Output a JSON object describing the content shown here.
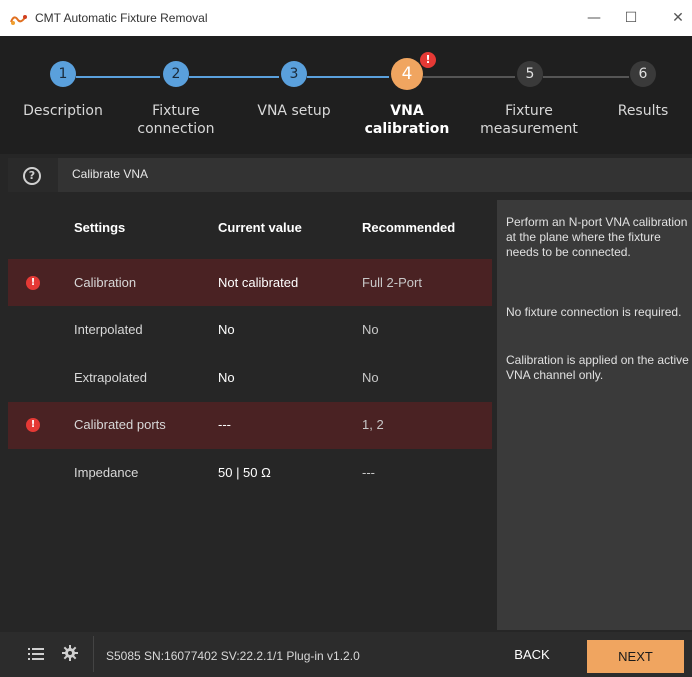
{
  "window": {
    "title": "CMT Automatic Fixture Removal",
    "minimize_glyph": "—",
    "maximize_glyph": "☐",
    "close_glyph": "✕"
  },
  "wizard": {
    "steps": [
      {
        "number": "1",
        "label_line1": "Description",
        "label_line2": "",
        "state": "done"
      },
      {
        "number": "2",
        "label_line1": "Fixture",
        "label_line2": "connection",
        "state": "done"
      },
      {
        "number": "3",
        "label_line1": "VNA setup",
        "label_line2": "",
        "state": "done"
      },
      {
        "number": "4",
        "label_line1": "VNA",
        "label_line2": "calibration",
        "state": "active",
        "badge": "!"
      },
      {
        "number": "5",
        "label_line1": "Fixture",
        "label_line2": "measurement",
        "state": "todo"
      },
      {
        "number": "6",
        "label_line1": "Results",
        "label_line2": "",
        "state": "todo"
      }
    ]
  },
  "header": {
    "help_glyph": "?",
    "title": "Calibrate VNA"
  },
  "table": {
    "columns": [
      "Settings",
      "Current value",
      "Recommended"
    ],
    "rows": [
      {
        "setting": "Calibration",
        "current": "Not calibrated",
        "recommended": "Full 2-Port",
        "warning": true
      },
      {
        "setting": "Interpolated",
        "current": "No",
        "recommended": "No",
        "warning": false
      },
      {
        "setting": "Extrapolated",
        "current": "No",
        "recommended": "No",
        "warning": false
      },
      {
        "setting": "Calibrated ports",
        "current": "---",
        "recommended": "1, 2",
        "warning": true
      },
      {
        "setting": "Impedance",
        "current": "50 | 50 Ω",
        "recommended": "---",
        "warning": false
      }
    ],
    "warning_glyph": "!"
  },
  "side_panel": {
    "paragraphs": [
      "Perform an N-port VNA calibration at the plane where the fixture needs to be connected.",
      "No fixture connection is required.",
      "Calibration is applied on the active VNA channel only."
    ]
  },
  "footer": {
    "status": "S5085 SN:16077402 SV:22.2.1/1 Plug-in v1.2.0",
    "back_label": "BACK",
    "next_label": "NEXT"
  },
  "colors": {
    "accent": "#f0a560",
    "done_step": "#5aa0dc",
    "warning_row": "#4a2223",
    "warning_icon": "#e53935"
  }
}
